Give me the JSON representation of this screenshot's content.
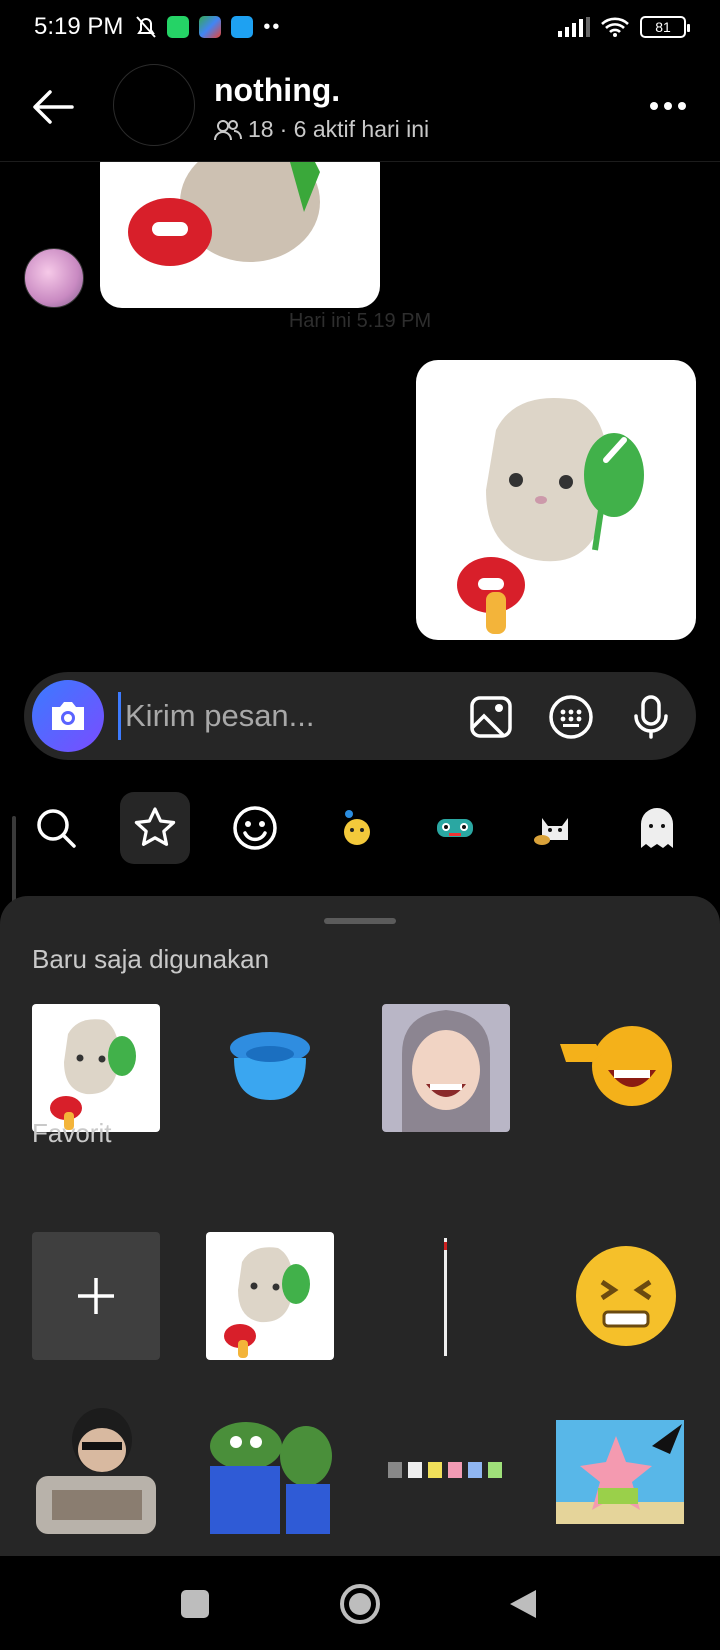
{
  "status_bar": {
    "time": "5:19 PM",
    "battery": "81"
  },
  "header": {
    "title": "nothing.",
    "member_count": "18",
    "active_text": "· 6 aktif hari ini"
  },
  "thread": {
    "time_divider": "Hari ini 5.19 PM"
  },
  "composer": {
    "placeholder": "Kirim pesan..."
  },
  "sticker_tabs": [
    "search",
    "favorites",
    "emoji",
    "sticker-pack-duck",
    "sticker-pack-monster",
    "sticker-pack-cat",
    "sticker-pack-ghost"
  ],
  "sheet": {
    "recent_title": "Baru saja digunakan",
    "favorites_title": "Favorit",
    "recent_stickers": [
      "cat-balloon-sticker",
      "blue-blob-sticker",
      "laughing-girl-sticker",
      "laughing-emoji-pointing-sticker"
    ],
    "favorite_stickers": [
      "add-favorite",
      "cat-balloon-sticker",
      "thin-line-sticker",
      "cringe-emoji-sticker",
      "guy-glasses-sticker",
      "pepe-frogs-sticker",
      "pixel-cats-sticker",
      "patrick-star-sticker"
    ]
  },
  "colors": {
    "accent": "#3d7bff",
    "camera_gradient_start": "#3a7bff",
    "camera_gradient_end": "#7a4cff",
    "sheet_bg": "#262626"
  }
}
